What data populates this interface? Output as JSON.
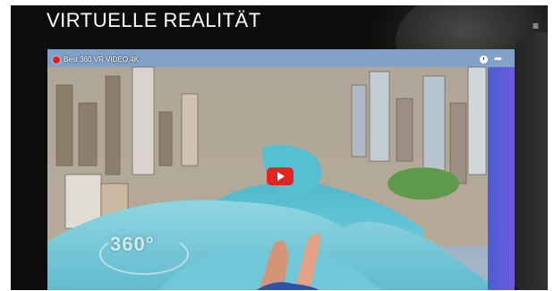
{
  "header": {
    "title": "VIRTUELLE REALITÄT",
    "menu_icon": "hamburger-icon",
    "menu_glyph": "≡"
  },
  "video": {
    "title": "Best 360 VR VIDEO 4K",
    "channel_icon": "red-dot-icon",
    "watch_later_icon": "clock-icon",
    "share_icon": "share-icon",
    "share_glyph": "➦",
    "play_icon": "play-icon",
    "overlay_badge": "360°"
  },
  "colors": {
    "play_button": "#e52421",
    "pool_water": "#5fc6d6",
    "sky": "#6e8fb5"
  }
}
